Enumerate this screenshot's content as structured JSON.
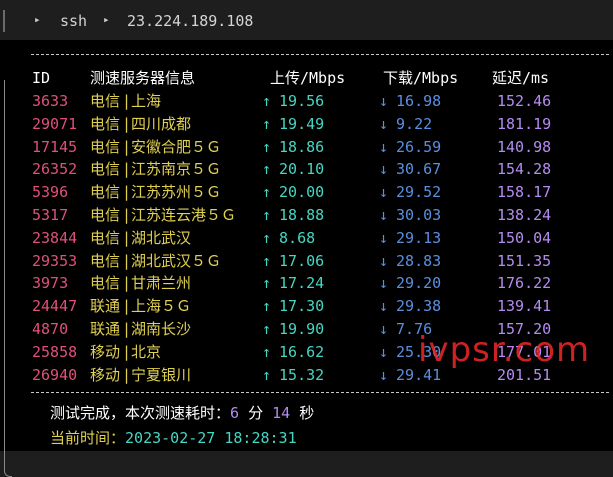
{
  "titlebar": {
    "command": "ssh",
    "host": "23.224.189.108"
  },
  "header": {
    "id": "ID",
    "server": "测速服务器信息",
    "upload": "上传/Mbps",
    "download": "下载/Mbps",
    "latency": "延迟/ms"
  },
  "rows": [
    {
      "id": "3633",
      "isp": "电信",
      "location": "上海",
      "up": "19.56",
      "down": "16.98",
      "latency": "152.46"
    },
    {
      "id": "29071",
      "isp": "电信",
      "location": "四川成都",
      "up": "19.49",
      "down": "9.22",
      "latency": "181.19"
    },
    {
      "id": "17145",
      "isp": "电信",
      "location": "安徽合肥５Ｇ",
      "up": "18.86",
      "down": "26.59",
      "latency": "140.98"
    },
    {
      "id": "26352",
      "isp": "电信",
      "location": "江苏南京５Ｇ",
      "up": "20.10",
      "down": "30.67",
      "latency": "154.28"
    },
    {
      "id": "5396",
      "isp": "电信",
      "location": "江苏苏州５Ｇ",
      "up": "20.00",
      "down": "29.52",
      "latency": "158.17"
    },
    {
      "id": "5317",
      "isp": "电信",
      "location": "江苏连云港５Ｇ",
      "up": "18.88",
      "down": "30.03",
      "latency": "138.24"
    },
    {
      "id": "23844",
      "isp": "电信",
      "location": "湖北武汉",
      "up": "8.68",
      "down": "29.13",
      "latency": "150.04"
    },
    {
      "id": "29353",
      "isp": "电信",
      "location": "湖北武汉５Ｇ",
      "up": "17.06",
      "down": "28.83",
      "latency": "151.35"
    },
    {
      "id": "3973",
      "isp": "电信",
      "location": "甘肃兰州",
      "up": "17.24",
      "down": "29.20",
      "latency": "176.22"
    },
    {
      "id": "24447",
      "isp": "联通",
      "location": "上海５Ｇ",
      "up": "17.30",
      "down": "29.38",
      "latency": "139.41"
    },
    {
      "id": "4870",
      "isp": "联通",
      "location": "湖南长沙",
      "up": "19.90",
      "down": "7.76",
      "latency": "157.20"
    },
    {
      "id": "25858",
      "isp": "移动",
      "location": "北京",
      "up": "16.62",
      "down": "25.30",
      "latency": "177.01"
    },
    {
      "id": "26940",
      "isp": "移动",
      "location": "宁夏银川",
      "up": "15.32",
      "down": "29.41",
      "latency": "201.51"
    }
  ],
  "symbols": {
    "pipe": "|",
    "up_arrow": "↑",
    "down_arrow": "↓"
  },
  "footer": {
    "done_prefix": "测试完成，本次测速耗时：",
    "minutes": "6",
    "minutes_unit": "分",
    "seconds": "14",
    "seconds_unit": "秒",
    "time_label": "当前时间：",
    "time_value": "2023-02-27 18:28:31"
  },
  "watermark": "ivpsr.com",
  "colors": {
    "id": "#e0507a",
    "location": "#e0d050",
    "upload": "#46d6c2",
    "download": "#5a8fe0",
    "latency": "#b48cf0",
    "watermark": "#f02828"
  }
}
